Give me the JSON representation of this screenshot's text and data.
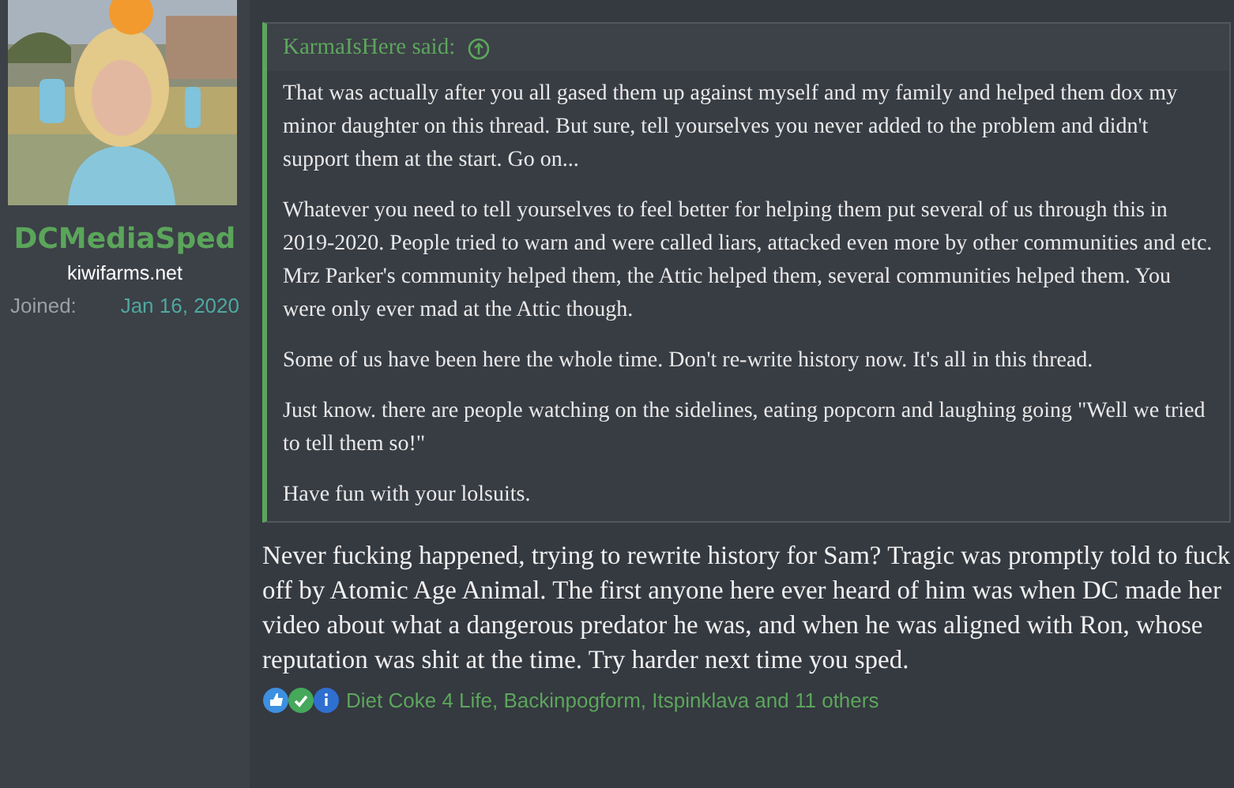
{
  "author": {
    "name": "DCMediaSped",
    "title": "kiwifarms.net",
    "joined_label": "Joined:",
    "joined_date": "Jan 16, 2020"
  },
  "quote": {
    "attribution": "KarmaIsHere said:",
    "paragraphs": [
      "That was actually after you all gased them up against myself and my family and helped them dox my minor daughter on this thread. But sure, tell yourselves you never added to the problem and didn't support them at the start. Go on...",
      "Whatever you need to tell yourselves to feel better for helping them put several of us through this in 2019-2020. People tried to warn and were called liars, attacked even more by other communities and etc. Mrz Parker's community helped them, the Attic helped them, several communities helped them. You were only ever mad at the Attic though.",
      "Some of us have been here the whole time. Don't re-write history now. It's all in this thread.",
      "Just know. there are people watching on the sidelines, eating popcorn and laughing going \"Well we tried to tell them so!\"",
      "Have fun with your lolsuits."
    ]
  },
  "body": "Never fucking happened, trying to rewrite history for Sam? Tragic was promptly told to fuck off by Atomic Age Animal. The first anyone here ever heard of him was when DC made her video about what a dangerous predator he was, and when he was aligned with Ron, whose reputation was shit at the time. Try harder next time you sped.",
  "reactions": {
    "icons": [
      {
        "kind": "like"
      },
      {
        "kind": "agree"
      },
      {
        "kind": "informative"
      }
    ],
    "summary": "Diet Coke 4 Life, Backinpogform, Itspinklava and 11 others"
  }
}
